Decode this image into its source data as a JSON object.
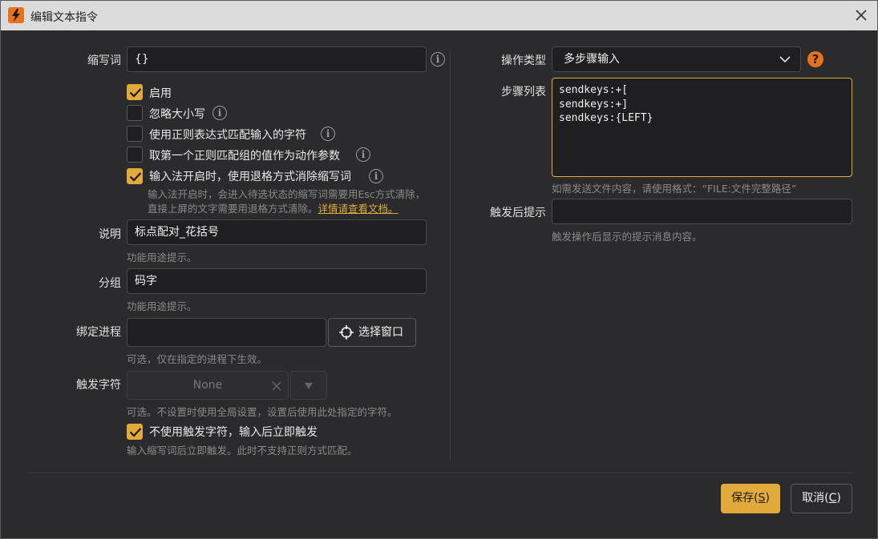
{
  "window": {
    "title": "编辑文本指令",
    "app_icon": "app-logo-icon",
    "close_icon": "close-icon"
  },
  "left": {
    "abbr": {
      "label": "缩写词",
      "value": "{}"
    },
    "options": [
      {
        "label": "启用",
        "checked": true,
        "info": false
      },
      {
        "label": "忽略大小写",
        "checked": false,
        "info": true
      },
      {
        "label": "使用正则表达式匹配输入的字符",
        "checked": false,
        "info": true
      },
      {
        "label": "取第一个正则匹配组的值作为动作参数",
        "checked": false,
        "info": true
      },
      {
        "label": "输入法开启时，使用退格方式消除缩写词",
        "checked": true,
        "info": true
      }
    ],
    "ime_hint_line1": "输入法开启时，会进入待选状态的缩写词需要用Esc方式清除，",
    "ime_hint_line2": "直接上屏的文字需要用退格方式清除。",
    "ime_hint_link": "详情请查看文档。",
    "description": {
      "label": "说明",
      "value": "标点配对_花括号",
      "hint": "功能用途提示。"
    },
    "group": {
      "label": "分组",
      "value": "码字",
      "hint": "功能用途提示。"
    },
    "process": {
      "label": "绑定进程",
      "value": "",
      "button": "选择窗口",
      "hint": "可选，仅在指定的进程下生效。"
    },
    "trigger": {
      "label": "触发字符",
      "value": "None",
      "hint": "可选。不设置时使用全局设置，设置后使用此处指定的字符。"
    },
    "no_trigger": {
      "label": "不使用触发字符，输入后立即触发",
      "checked": true,
      "hint": "输入缩写词后立即触发。此时不支持正则方式匹配。"
    }
  },
  "right": {
    "action_type": {
      "label": "操作类型",
      "value": "多步骤输入"
    },
    "steps": {
      "label": "步骤列表",
      "lines": [
        "sendkeys:+[",
        "sendkeys:+]",
        "sendkeys:{LEFT}"
      ],
      "hint": "如需发送文件内容，请使用格式：“FILE:文件完整路径”"
    },
    "after_trigger": {
      "label": "触发后提示",
      "value": "",
      "hint": "触发操作后显示的提示消息内容。"
    }
  },
  "footer": {
    "save_label": "保存(",
    "save_key": "S",
    "save_end": ")",
    "cancel_label": "取消(",
    "cancel_key": "C",
    "cancel_end": ")"
  },
  "colors": {
    "accent": "#e2a93b",
    "brand": "#e8731c",
    "background": "#2b2b2d"
  }
}
